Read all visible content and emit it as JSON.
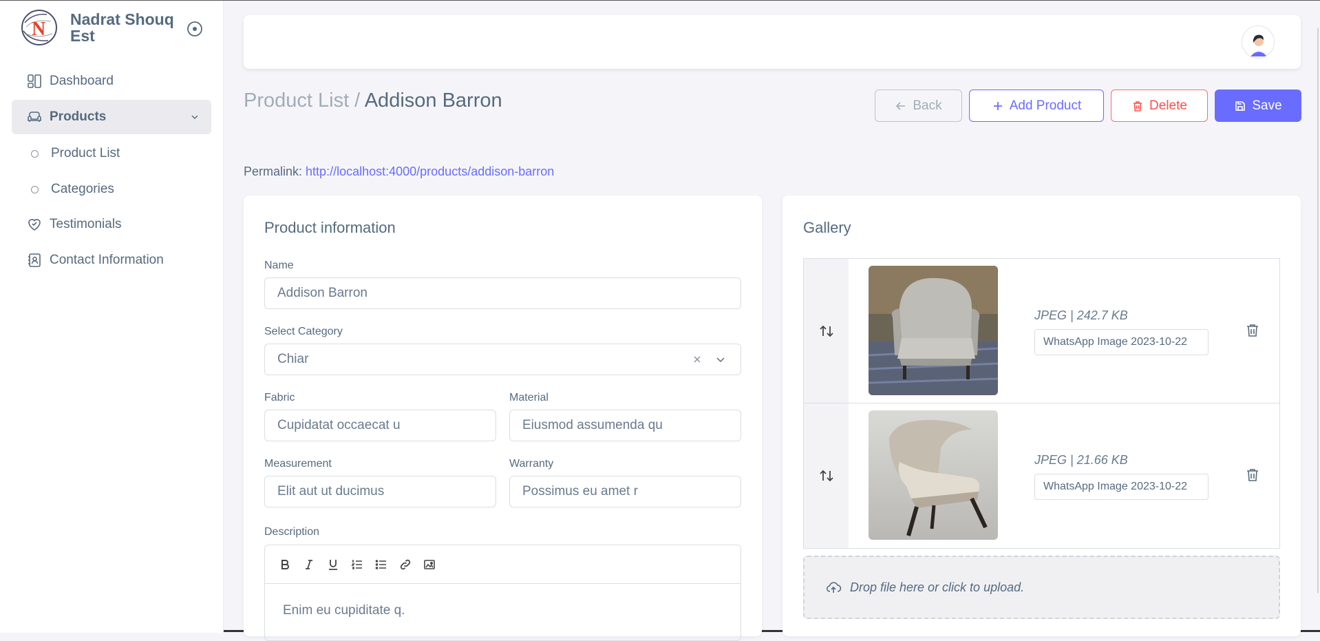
{
  "brand": {
    "name": "Nadrat Shouq Est",
    "logo_letter": "N"
  },
  "sidebar": {
    "items": [
      {
        "label": "Dashboard",
        "icon": "dashboard-icon"
      },
      {
        "label": "Products",
        "icon": "sofa-icon",
        "active": true
      },
      {
        "label": "Product List"
      },
      {
        "label": "Categories"
      },
      {
        "label": "Testimonials",
        "icon": "heart-handshake-icon"
      },
      {
        "label": "Contact Information",
        "icon": "contact-book-icon"
      }
    ]
  },
  "header": {
    "breadcrumb_parent": "Product List /",
    "breadcrumb_current": "Addison Barron"
  },
  "actions": {
    "back": "Back",
    "add": "Add Product",
    "delete": "Delete",
    "save": "Save"
  },
  "permalink": {
    "label": "Permalink:",
    "url": "http://localhost:4000/products/addison-barron"
  },
  "product_info": {
    "title": "Product information",
    "name_label": "Name",
    "name_value": "Addison Barron",
    "category_label": "Select Category",
    "category_value": "Chiar",
    "fabric_label": "Fabric",
    "fabric_value": "Cupidatat occaecat u",
    "material_label": "Material",
    "material_value": "Eiusmod assumenda qu",
    "measurement_label": "Measurement",
    "measurement_value": "Elit aut ut ducimus",
    "warranty_label": "Warranty",
    "warranty_value": "Possimus eu amet r",
    "description_label": "Description",
    "description_value": "Enim eu cupiditate q."
  },
  "gallery": {
    "title": "Gallery",
    "items": [
      {
        "meta": "JPEG | 242.7 KB",
        "name": "WhatsApp Image 2023-10-22"
      },
      {
        "meta": "JPEG | 21.66 KB",
        "name": "WhatsApp Image 2023-10-22"
      }
    ],
    "dropzone": "Drop file here or click to upload."
  },
  "colors": {
    "primary": "#696cff",
    "danger": "#ff4d49",
    "text": "#566a7f"
  }
}
